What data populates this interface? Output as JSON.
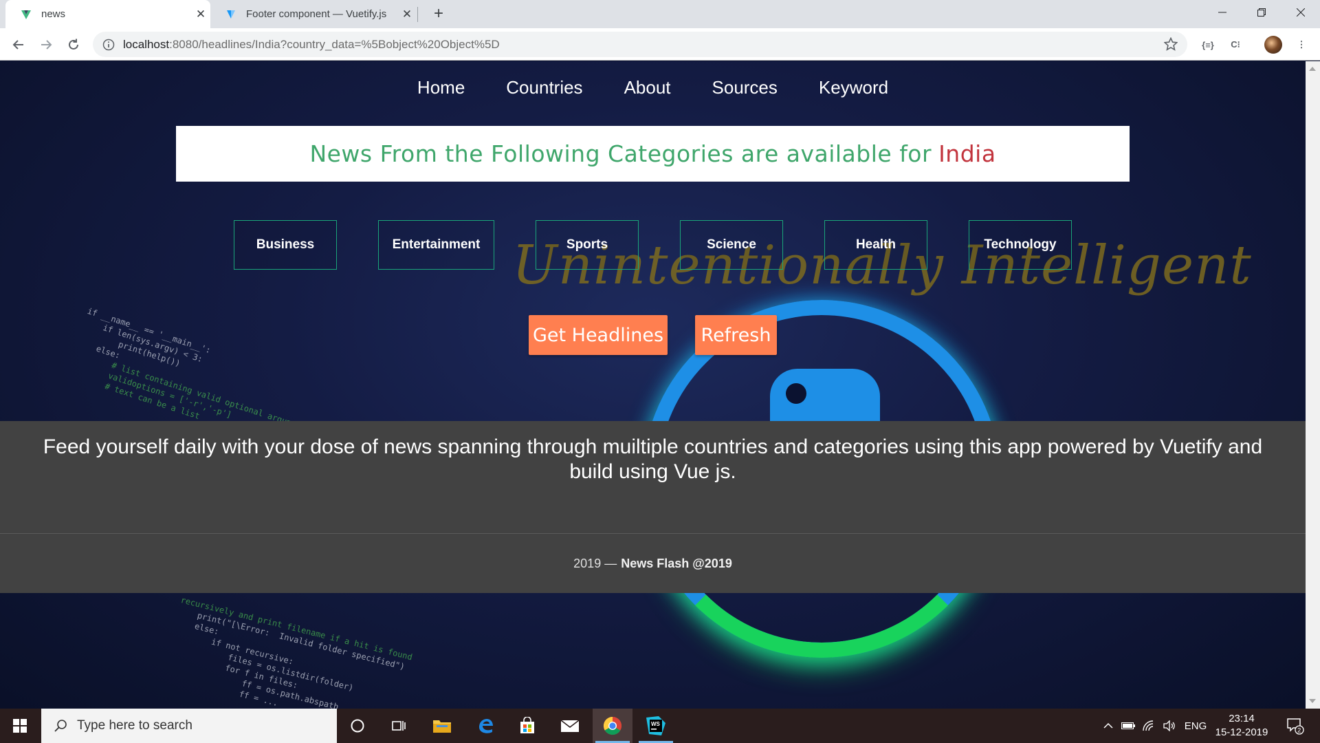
{
  "browser": {
    "tabs": [
      {
        "title": "news",
        "active": true
      },
      {
        "title": "Footer component — Vuetify.js",
        "active": false
      }
    ],
    "url_host": "localhost",
    "url_rest": ":8080/headlines/India?country_data=%5Bobject%20Object%5D"
  },
  "nav": {
    "items": [
      "Home",
      "Countries",
      "About",
      "Sources",
      "Keyword"
    ]
  },
  "banner": {
    "text": "News From the Following Categories are available for",
    "country": "India"
  },
  "background": {
    "logo_text": "Unintentionally Intelligent",
    "code_top": "if __name__ == '__main__':\n    if len(sys.argv) < 3:\n        print(help())\n    else:",
    "code_top_green": "        # list containing valid optional arguments\n        validoptions = ['-r','-p']\n        # text can be a list",
    "code_bottom": "    print(\"[\\Error:  Invalid folder specified\")\n    else:\n        if not recursive:\n            files = os.listdir(folder)\n            for f in files:\n                ff = os.path.abspath\n                ff = ...",
    "code_bottom_green": "recursively and print filename if a hit is found"
  },
  "categories": [
    "Business",
    "Entertainment",
    "Sports",
    "Science",
    "Health",
    "Technology"
  ],
  "buttons": {
    "get_headlines": "Get Headlines",
    "refresh": "Refresh"
  },
  "footer": {
    "description": "Feed yourself daily with your dose of news spanning through muiltiple countries and categories using this app powered by Vuetify and build using Vue js.",
    "year": "2019 —",
    "brand": "News Flash @2019"
  },
  "taskbar": {
    "search_placeholder": "Type here to search",
    "language": "ENG",
    "time": "23:14",
    "date": "15-12-2019",
    "notifications": "2"
  },
  "colors": {
    "banner_green": "#3fa66b",
    "banner_red": "#c2343d",
    "button_orange": "#ff7f50",
    "category_border": "#1aa67a",
    "footer_bg": "#424242"
  }
}
